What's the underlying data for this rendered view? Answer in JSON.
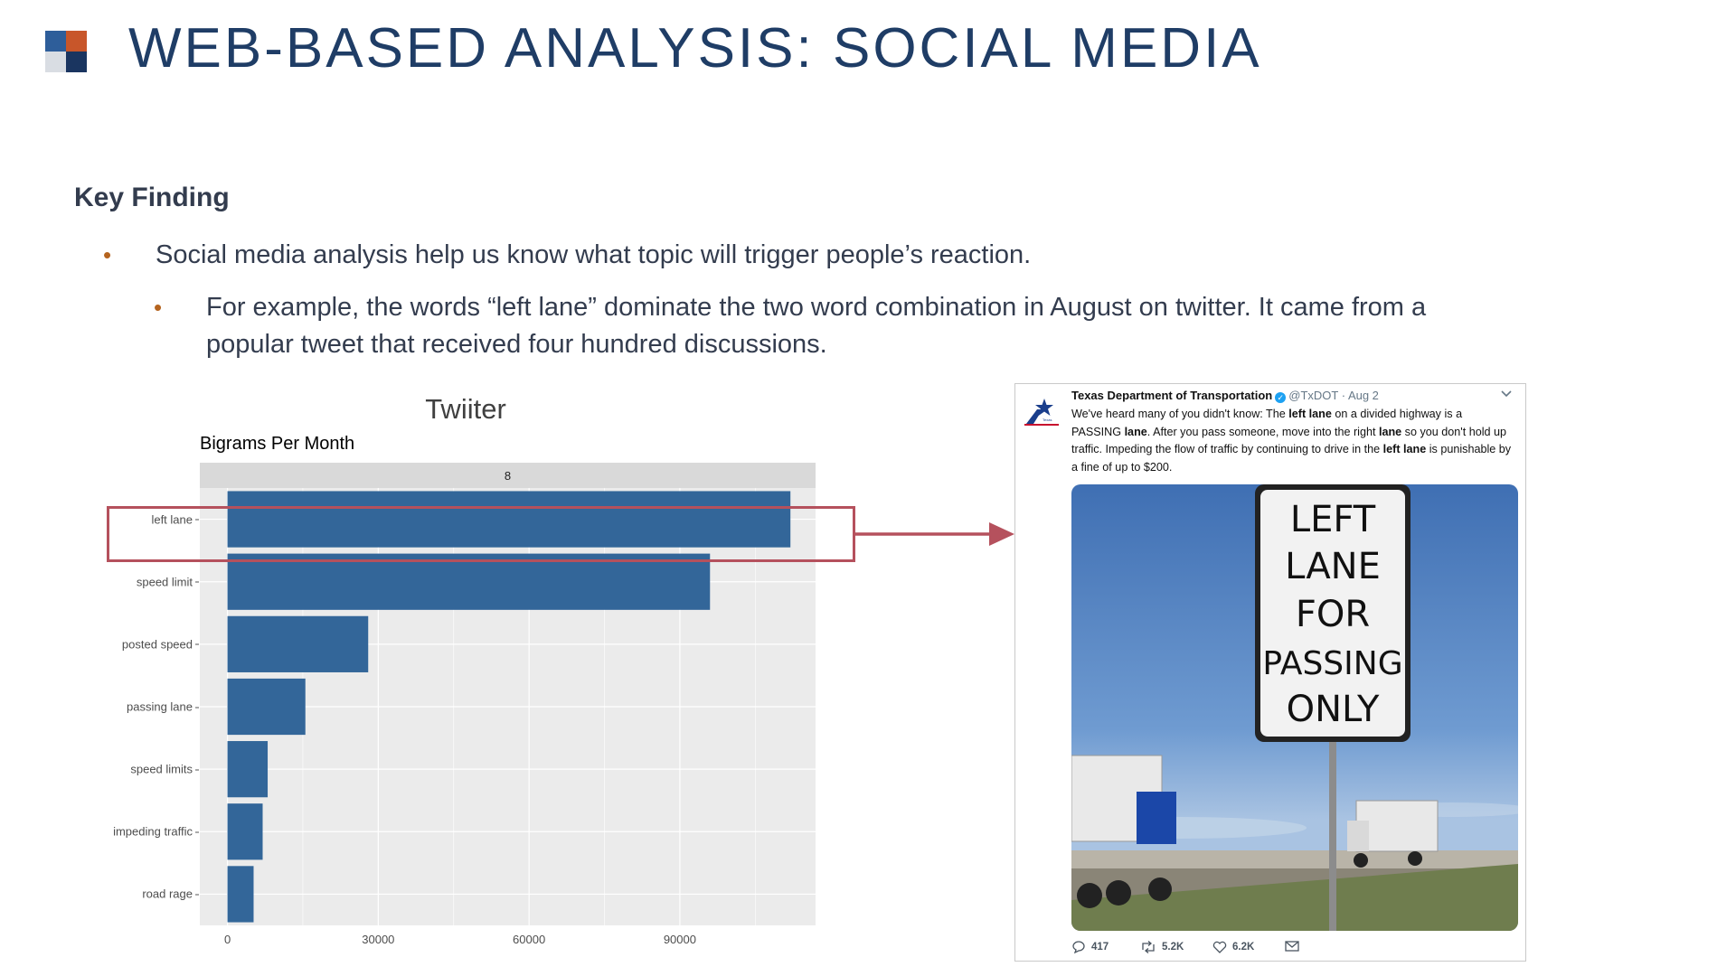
{
  "slide": {
    "title": "WEB-BASED ANALYSIS: SOCIAL MEDIA",
    "logo_colors": [
      "#2e5e9a",
      "#c8562a",
      "#d9dde3",
      "#1a3560"
    ]
  },
  "key_finding": {
    "heading": "Key Finding",
    "bullets": [
      "Social media analysis help us know what topic will trigger people’s reaction.",
      "For example, the words “left lane” dominate the two word combination in August on twitter. It came from a popular tweet that received four hundred discussions."
    ]
  },
  "chart_data": {
    "type": "bar",
    "orientation": "horizontal",
    "title": "Twiiter",
    "subtitle": "Bigrams Per Month",
    "facet_label": "8",
    "categories": [
      "left lane",
      "speed limit",
      "posted speed",
      "passing lane",
      "speed limits",
      "impeding traffic",
      "road rage"
    ],
    "values": [
      112000,
      96000,
      28000,
      15500,
      8000,
      7000,
      5200
    ],
    "xlim": [
      -5500,
      117000
    ],
    "xticks": [
      0,
      30000,
      60000,
      90000
    ],
    "xtick_labels": [
      "0",
      "30000",
      "60000",
      "90000"
    ],
    "grid": true,
    "bar_color": "#336699",
    "panel_color": "#ebebeb",
    "highlight_category": "left lane",
    "highlight_color": "#b5515d"
  },
  "tweet": {
    "author": "Texas Department of Transportation",
    "handle": "@TxDOT",
    "date": "· Aug 2",
    "text_segments": [
      {
        "t": "We've heard many of you didn't know: The ",
        "b": false
      },
      {
        "t": "left lane",
        "b": true
      },
      {
        "t": " on a divided highway is a PASSING ",
        "b": false
      },
      {
        "t": "lane",
        "b": true
      },
      {
        "t": ". After you pass someone, move into the right ",
        "b": false
      },
      {
        "t": "lane",
        "b": true
      },
      {
        "t": " so you don't hold up traffic. Impeding the flow of traffic by continuing to drive in the ",
        "b": false
      },
      {
        "t": "left lane",
        "b": true
      },
      {
        "t": " is punishable by a fine of up to $200.",
        "b": false
      }
    ],
    "sign_lines": [
      "LEFT",
      "LANE",
      "FOR",
      "PASSING",
      "ONLY"
    ],
    "replies": "417",
    "retweets": "5.2K",
    "likes": "6.2K",
    "icons": [
      "reply-icon",
      "retweet-icon",
      "like-icon",
      "mail-icon",
      "chevron-down-icon"
    ]
  }
}
